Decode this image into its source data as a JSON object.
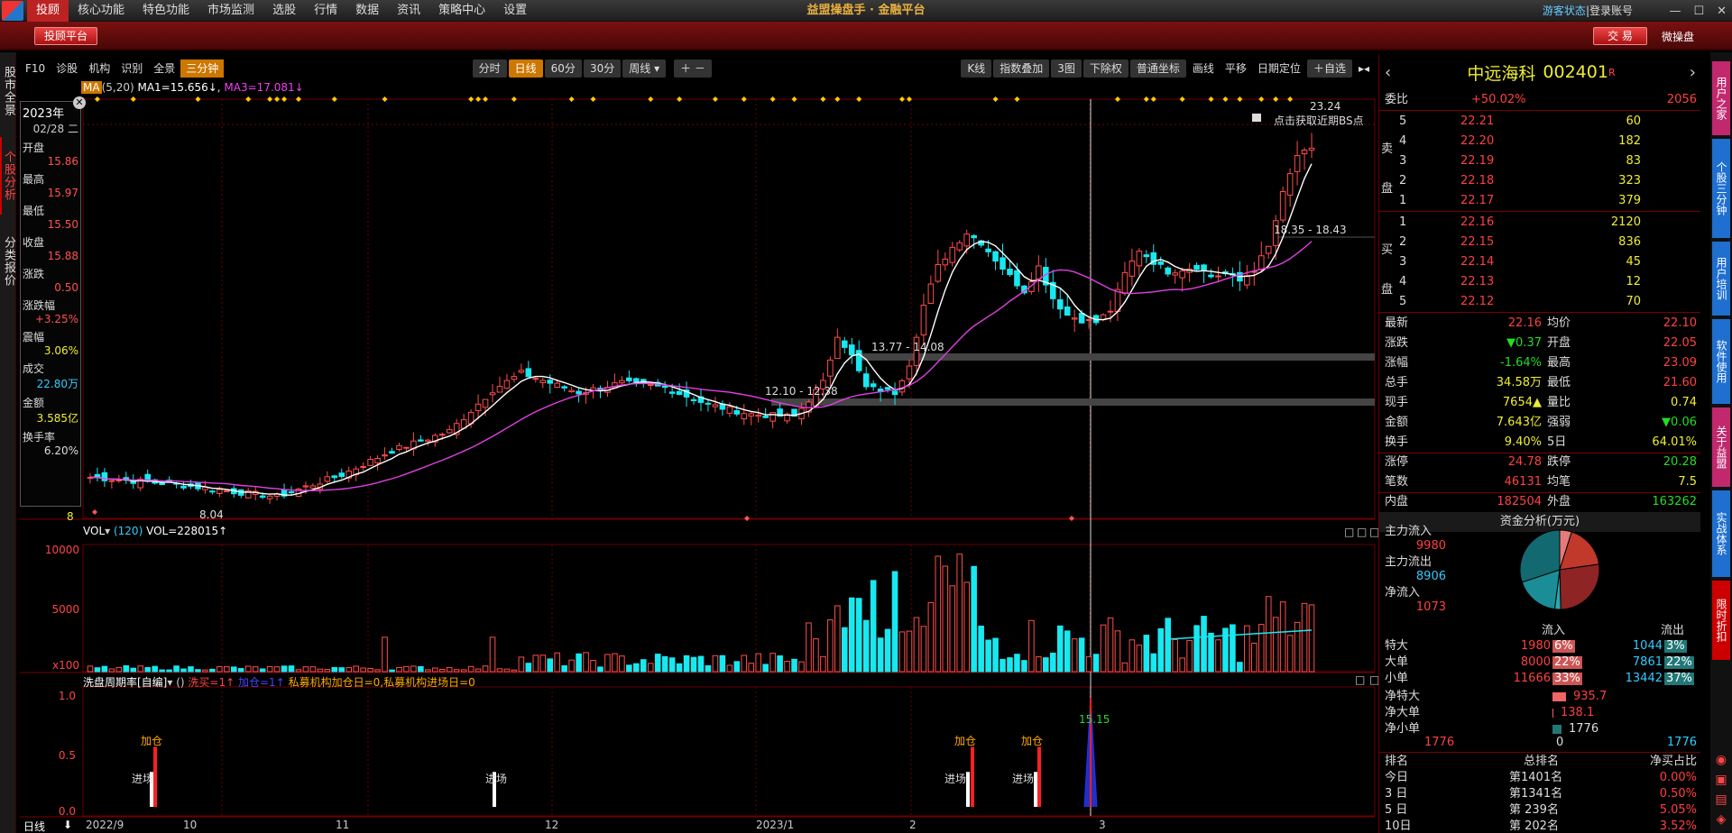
{
  "menu": {
    "items": [
      "投顾",
      "核心功能",
      "特色功能",
      "市场监测",
      "选股",
      "行情",
      "数据",
      "资讯",
      "策略中心",
      "设置"
    ]
  },
  "app_title": "益盟操盘手 · 金融平台",
  "login": {
    "guest": "游客状态",
    "sep": "|",
    "login": "登录账号"
  },
  "redbar": {
    "platform": "投顾平台",
    "trade": "交 易",
    "wechat": "微操盘"
  },
  "left_tabs": [
    "股市全景",
    "个股分析",
    "分类报价"
  ],
  "right_tabs": [
    "用户之家",
    "个股三分钟",
    "用户培训",
    "软件使用",
    "关于益盟",
    "实战体系",
    "限时折扣"
  ],
  "toolbar": {
    "f10": "F10",
    "zhenggu": "诊股",
    "jigou": "机构",
    "shibie": "识别",
    "quanjing": "全景",
    "sanfenzhong": "三分钟",
    "period": [
      "分时",
      "日线",
      "60分",
      "30分",
      "周线"
    ],
    "kline": "K线",
    "overlay": "指数叠加",
    "charts": "3图",
    "exright": "下除权",
    "coord": "普通坐标",
    "draw": "画线",
    "pan": "平移",
    "datepos": "日期定位",
    "selfsel": "自选"
  },
  "ma_legend": {
    "tag": "MA",
    "params": "(5,20)",
    "ma1": "MA1=15.656↓",
    "ma3": "MA3=17.081↓"
  },
  "infobox": {
    "year": "2023年",
    "date": "02/28 二",
    "open_l": "开盘",
    "open": "15.86",
    "high_l": "最高",
    "high": "15.97",
    "low_l": "最低",
    "low": "15.50",
    "close_l": "收盘",
    "close": "15.88",
    "chg_l": "涨跌",
    "chg": "0.50",
    "chgp_l": "涨跌幅",
    "chgp": "+3.25%",
    "amp_l": "震幅",
    "amp": "3.06%",
    "vol_l": "成交",
    "vol": "22.80万",
    "amt_l": "金额",
    "amt": "3.585亿",
    "turn_l": "换手率",
    "turn": "6.20%"
  },
  "annotations": {
    "high": "23.24",
    "low": "8.04",
    "zone1": "12.10 - 12.38",
    "zone2": "13.77 - 14.08",
    "zone3": "18.35 - 18.43",
    "bs": "点击获取近期BS点",
    "ind": "15.15",
    "left_num": "8"
  },
  "vol_legend": {
    "tag": "VOL",
    "params": "(120)",
    "vol": "VOL=228015↑",
    "ticks": [
      "10000",
      "5000",
      "x100"
    ]
  },
  "ind_legend": {
    "name": "洗盘周期率[自编]",
    "args": "()",
    "a": "洗买=1↑",
    "b": "加仓=1↑",
    "c": "私募机构加仓日=0,私募机构进场日=0",
    "ticks": [
      "1.0",
      "0.5",
      "0.0"
    ],
    "labels": {
      "jc": "进场",
      "jiacang": "加仓"
    }
  },
  "xaxis": {
    "period": "日线",
    "labels": [
      "2022/9",
      "10",
      "11",
      "12",
      "2023/1",
      "2",
      "3"
    ]
  },
  "quote": {
    "name": "中远海科",
    "code": "002401",
    "flag": "R",
    "webi_l": "委比",
    "webi": "+50.02%",
    "webi_n": "2056",
    "asks": [
      [
        "5",
        "22.21",
        "60"
      ],
      [
        "4",
        "22.20",
        "182"
      ],
      [
        "3",
        "22.19",
        "83"
      ],
      [
        "2",
        "22.18",
        "323"
      ],
      [
        "1",
        "22.17",
        "379"
      ]
    ],
    "bids": [
      [
        "1",
        "22.16",
        "2120"
      ],
      [
        "2",
        "22.15",
        "836"
      ],
      [
        "3",
        "22.14",
        "45"
      ],
      [
        "4",
        "22.13",
        "12"
      ],
      [
        "5",
        "22.12",
        "70"
      ]
    ],
    "sell": "卖",
    "buy": "买",
    "pan": "盘",
    "stats": [
      [
        "最新",
        "22.16",
        "均价",
        "22.10"
      ],
      [
        "涨跌",
        "▼0.37",
        "开盘",
        "22.05"
      ],
      [
        "涨幅",
        "-1.64%",
        "最高",
        "23.09"
      ],
      [
        "总手",
        "34.58万",
        "最低",
        "21.60"
      ],
      [
        "现手",
        "7654▲",
        "量比",
        "0.74"
      ],
      [
        "金额",
        "7.643亿",
        "强弱",
        "▼0.06"
      ],
      [
        "换手",
        "9.40%",
        "5日",
        "64.01%"
      ],
      [
        "涨停",
        "24.78",
        "跌停",
        "20.28"
      ],
      [
        "笔数",
        "46131",
        "均笔",
        "7.5"
      ],
      [
        "内盘",
        "182504",
        "外盘",
        "163262"
      ]
    ],
    "fund_title": "资金分析(万元)",
    "fund": [
      [
        "主力流入",
        "9980"
      ],
      [
        "主力流出",
        "8906"
      ],
      [
        "净流入",
        "1073"
      ]
    ],
    "flow_head": [
      "流入",
      "流出"
    ],
    "flows": [
      [
        "特大",
        "1980",
        "6%",
        "1044",
        "3%"
      ],
      [
        "大单",
        "8000",
        "22%",
        "7861",
        "22%"
      ],
      [
        "小单",
        "11666",
        "33%",
        "13442",
        "37%"
      ]
    ],
    "net": [
      [
        "净特大",
        "935.7"
      ],
      [
        "净大单",
        "138.1"
      ],
      [
        "净小单",
        "1776"
      ]
    ],
    "net_scale": [
      "1776",
      "0",
      "1776"
    ],
    "rank_head": [
      "排名",
      "总排名",
      "净买占比"
    ],
    "ranks": [
      [
        "今日",
        "第1401名",
        "0.00%"
      ],
      [
        "3 日",
        "第1341名",
        "0.50%"
      ],
      [
        "5 日",
        "第 239名",
        "5.05%"
      ],
      [
        "10日",
        "第 202名",
        "3.52%"
      ]
    ]
  }
}
